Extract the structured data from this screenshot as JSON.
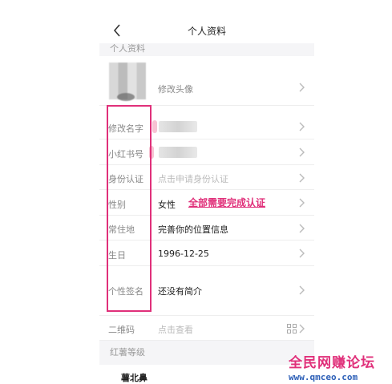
{
  "nav": {
    "title": "个人资料"
  },
  "section_top": "个人资料",
  "avatar_row": {
    "label": "修改头像"
  },
  "rows": {
    "name": {
      "label": "修改名字"
    },
    "redbook_id": {
      "label": "小红书号"
    },
    "id_verify": {
      "label": "身份认证",
      "value": "点击申请身份认证"
    },
    "gender": {
      "label": "性别",
      "value": "女性"
    },
    "residence": {
      "label": "常住地",
      "value": "完善你的位置信息"
    },
    "birthday": {
      "label": "生日",
      "value": "1996-12-25"
    },
    "signature": {
      "label": "个性签名",
      "value": "还没有简介"
    },
    "qrcode": {
      "label": "二维码",
      "value": "点击查看"
    }
  },
  "annotation": {
    "text": "全部需要完成认证"
  },
  "section_level": "红薯等级",
  "level_row": {
    "value": "薯北鼻"
  },
  "watermark": {
    "title": "全民网赚论坛",
    "url": "www.qmceo.com"
  },
  "colors": {
    "accent": "#e0307a",
    "section_bg": "#f5f5f7"
  }
}
